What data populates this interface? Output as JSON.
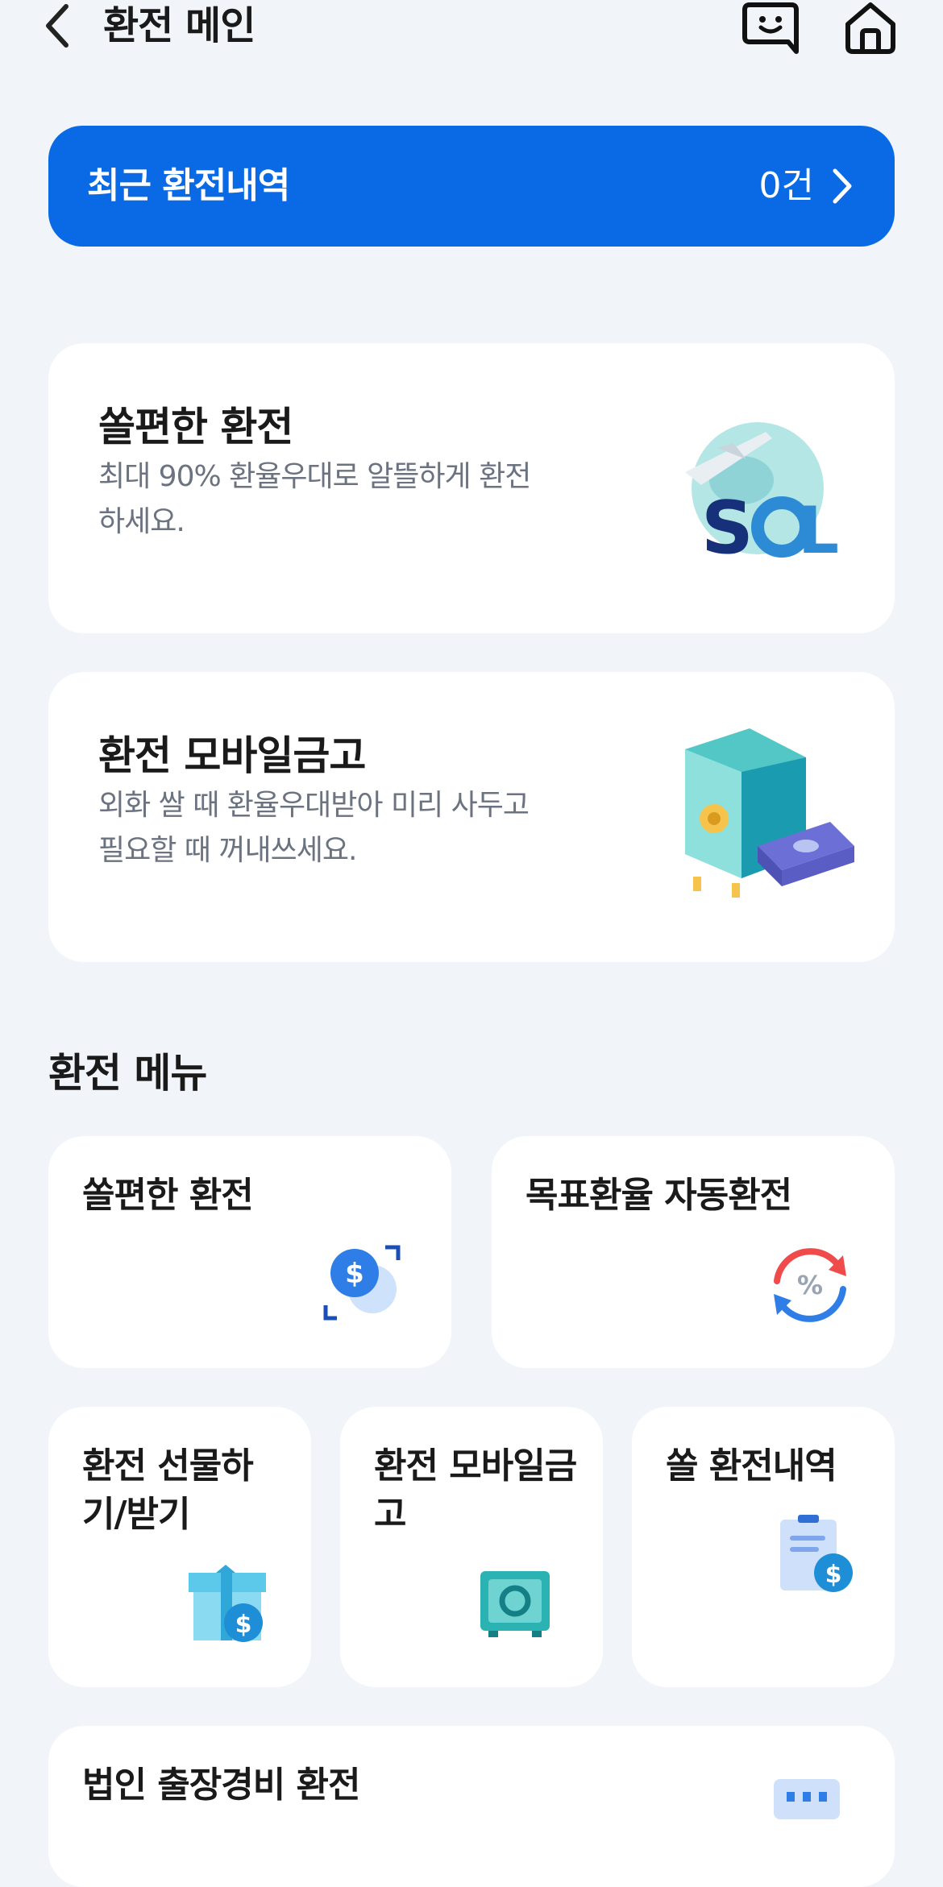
{
  "header": {
    "title": "환전 메인",
    "back_icon": "chevron-left-icon",
    "chat_icon": "chat-smile-icon",
    "home_icon": "home-icon"
  },
  "recent": {
    "label": "최근 환전내역",
    "count": "0건"
  },
  "promos": [
    {
      "title": "쏠편한 환전",
      "desc": "최대 90% 환율우대로 알뜰하게 환전하세요.",
      "illustration": "sol-globe-plane-icon"
    },
    {
      "title": "환전 모바일금고",
      "desc": "외화 쌀 때 환율우대받아 미리 사두고 필요할 때 꺼내쓰세요.",
      "illustration": "safe-with-cash-icon"
    }
  ],
  "menu": {
    "title": "환전 메뉴",
    "items": [
      {
        "label": "쏠편한 환전",
        "icon": "dollar-exchange-icon"
      },
      {
        "label": "목표환율 자동환전",
        "icon": "percent-cycle-icon"
      },
      {
        "label": "환전 선물하기/받기",
        "icon": "gift-dollar-icon"
      },
      {
        "label": "환전 모바일금고",
        "icon": "safe-icon"
      },
      {
        "label": "쏠 환전내역",
        "icon": "receipt-dollar-icon"
      },
      {
        "label": "법인 출장경비 환전",
        "icon": "calendar-icon"
      }
    ]
  },
  "colors": {
    "accent": "#0a6ae6",
    "background": "#f1f4f9",
    "card": "#ffffff",
    "muted_text": "#6b7280"
  }
}
